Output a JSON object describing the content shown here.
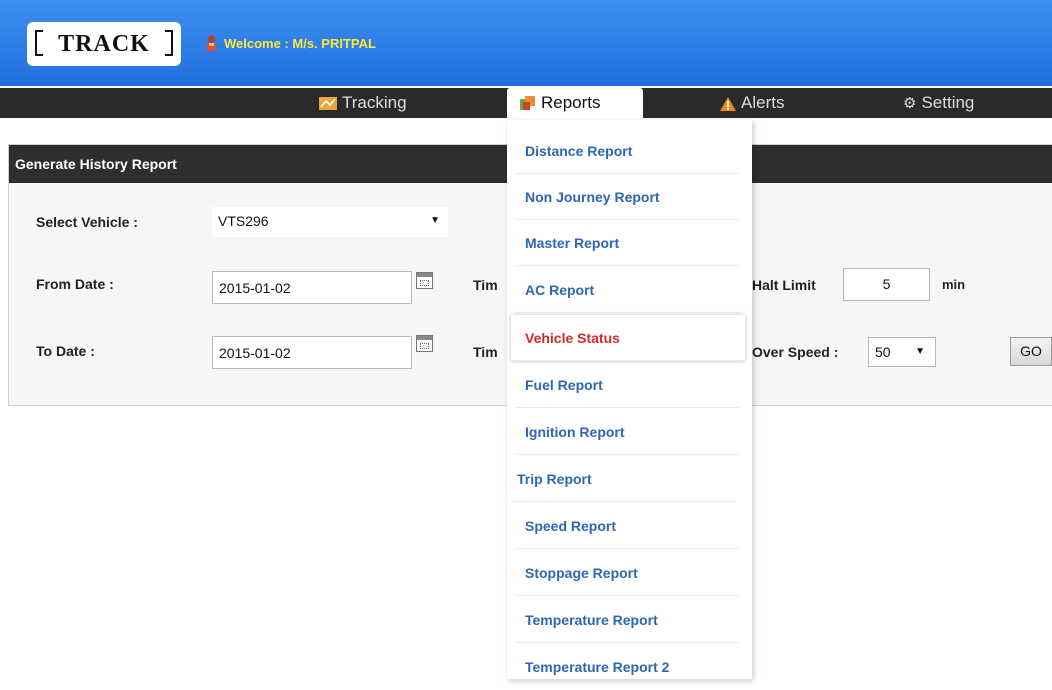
{
  "header": {
    "logo": "TRACK",
    "welcome": "Welcome : M/s. PRITPAL"
  },
  "nav": {
    "items": [
      {
        "label": "Tracking",
        "icon": "tracking-map-icon"
      },
      {
        "label": "Reports",
        "icon": "reports-icon"
      },
      {
        "label": "Alerts",
        "icon": "alert-warning-icon"
      },
      {
        "label": "Setting",
        "icon": "gear-icon"
      }
    ]
  },
  "panel": {
    "title": "Generate History Report",
    "select_vehicle_label": "Select Vehicle :",
    "vehicle_value": "VTS296",
    "from_date_label": "From Date :",
    "from_date_value": "2015-01-02",
    "to_date_label": "To Date :",
    "to_date_value": "2015-01-02",
    "time_label_1": "Tim",
    "time_label_2": "Tim",
    "halt_limit_label": "Halt Limit",
    "halt_limit_value": "5",
    "halt_unit": "min",
    "over_speed_label": "Over Speed :",
    "over_speed_value": "50",
    "go_label": "GO"
  },
  "reports_menu": {
    "items": [
      "Distance Report",
      "Non Journey Report",
      "Master Report",
      "AC Report",
      "Vehicle Status",
      "Fuel Report",
      "Ignition Report",
      "Trip Report",
      "Speed Report",
      "Stoppage Report",
      "Temperature Report",
      "Temperature Report 2"
    ],
    "active_index": 4
  },
  "colors": {
    "header_blue": "#2a7ae8",
    "nav_dark": "#2a2a2a",
    "menu_link": "#2f66b3",
    "menu_active": "#d32a2a",
    "welcome_yellow": "#ffe83a"
  }
}
